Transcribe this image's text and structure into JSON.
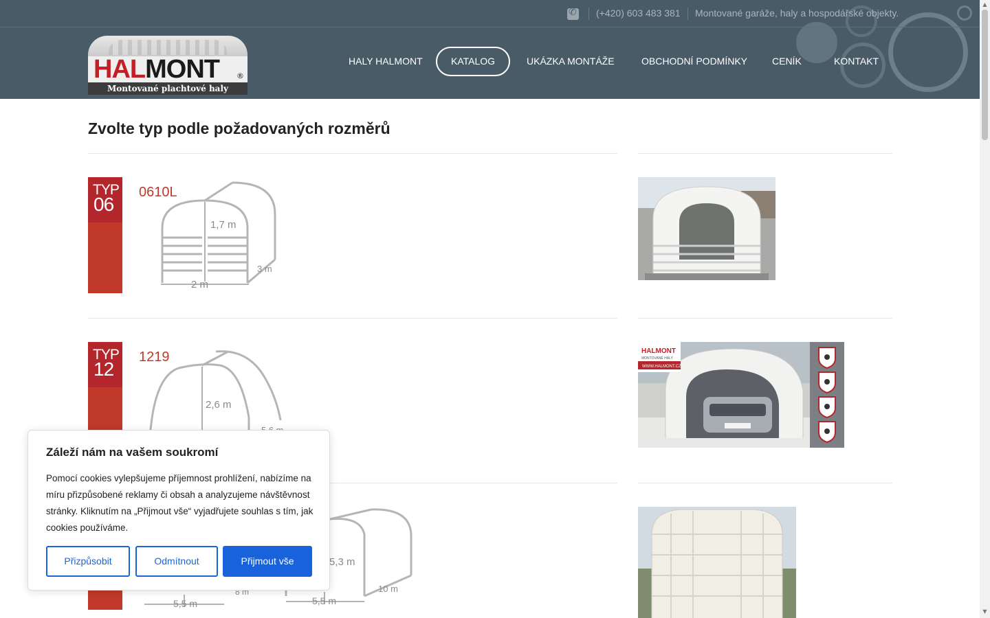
{
  "header": {
    "phone": "(+420) 603 483 381",
    "tagline": "Montované garáže, haly a hospodářské objekty.",
    "logo": {
      "name_red": "HAL",
      "name_black": "MONT",
      "reg": "®",
      "subtitle": "Montované plachtové haly"
    },
    "nav": [
      {
        "label": "HALY HALMONT"
      },
      {
        "label": "KATALOG"
      },
      {
        "label": "UKÁZKA MONTÁŽE"
      },
      {
        "label": "OBCHODNÍ PODMÍNKY"
      },
      {
        "label": "CENÍK"
      },
      {
        "label": "KONTAKT"
      }
    ]
  },
  "main": {
    "title": "Zvolte typ podle požadovaných rozměrů",
    "items": [
      {
        "typ_label": "TYP",
        "typ_num": "06",
        "code": "0610L",
        "dims": [
          "1,7 m",
          "2 m",
          "3 m"
        ]
      },
      {
        "typ_label": "TYP",
        "typ_num": "12",
        "code": "1219",
        "dims": [
          "2,6 m",
          "5,6 m"
        ]
      },
      {
        "dims": [
          "5,3 m",
          "8 m",
          "5,5 m",
          "5,5 m",
          "10 m"
        ]
      }
    ],
    "banner": {
      "brand": "HALMONT",
      "sub": "MONTOVANÉ HALY",
      "url": "WWW.HALMONT.CZ"
    }
  },
  "cookie": {
    "title": "Záleží nám na vašem soukromí",
    "body": "Pomocí cookies vylepšujeme příjemnost prohlížení, nabízíme na míru přizpůsobené reklamy či obsah a analyzujeme návštěvnost stránky. Kliknutím na „Přijmout vše“ vyjadřujete souhlas s tím, jak cookies používáme.",
    "customize": "Přizpůsobit",
    "reject": "Odmítnout",
    "accept": "Přijmout vše"
  },
  "colors": {
    "header_bg": "#4a5b68",
    "accent_red": "#c0392b",
    "cookie_blue": "#1863dc"
  },
  "icons": {
    "phone": "phone-icon"
  }
}
